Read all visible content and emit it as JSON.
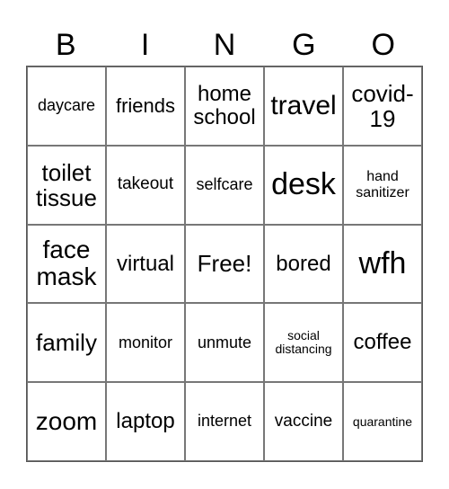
{
  "header": {
    "letters": [
      "B",
      "I",
      "N",
      "G",
      "O"
    ]
  },
  "grid": {
    "rows": [
      [
        "daycare",
        "friends",
        "home school",
        "travel",
        "covid-19"
      ],
      [
        "toilet tissue",
        "takeout",
        "selfcare",
        "desk",
        "hand sanitizer"
      ],
      [
        "face mask",
        "virtual",
        "Free!",
        "bored",
        "wfh"
      ],
      [
        "family",
        "monitor",
        "unmute",
        "social distancing",
        "coffee"
      ],
      [
        "zoom",
        "laptop",
        "internet",
        "vaccine",
        "quarantine"
      ]
    ]
  }
}
